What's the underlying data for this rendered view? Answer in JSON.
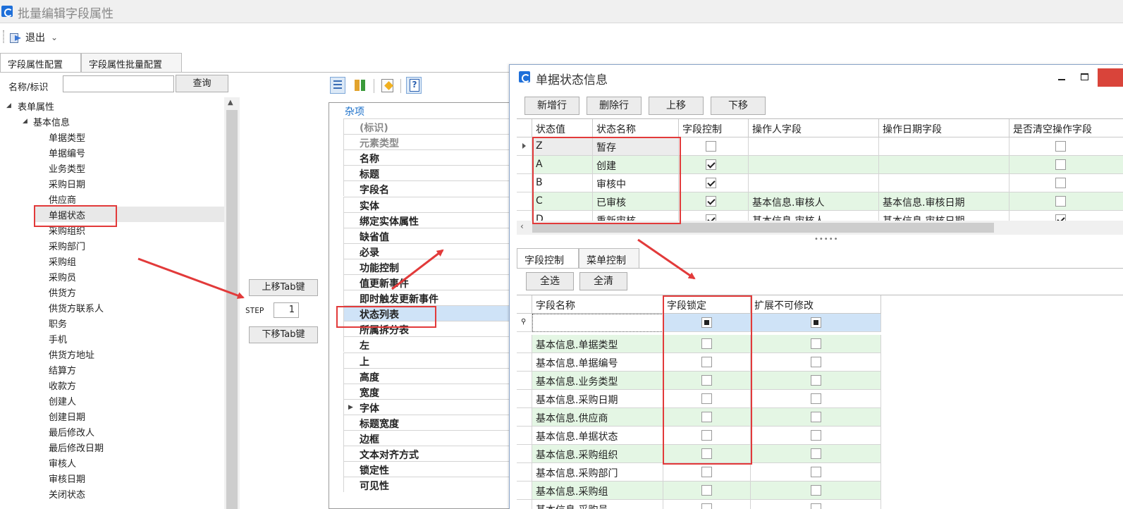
{
  "window": {
    "title": "批量编辑字段属性"
  },
  "toolbar": {
    "exit_label": "退出",
    "exit_chevron": "⌄"
  },
  "tabs": [
    {
      "label": "字段属性配置",
      "active": true
    },
    {
      "label": "字段属性批量配置",
      "active": false
    }
  ],
  "search": {
    "label": "名称/标识",
    "value": "",
    "button": "查询"
  },
  "tree": {
    "root": "表单属性",
    "group": "基本信息",
    "items": [
      "单据类型",
      "单据编号",
      "业务类型",
      "采购日期",
      "供应商",
      "单据状态",
      "采购组织",
      "采购部门",
      "采购组",
      "采购员",
      "供货方",
      "供货方联系人",
      "职务",
      "手机",
      "供货方地址",
      "结算方",
      "收款方",
      "创建人",
      "创建日期",
      "最后修改人",
      "最后修改日期",
      "审核人",
      "审核日期",
      "关闭状态"
    ],
    "selected": "单据状态"
  },
  "mid": {
    "up_button": "上移Tab键",
    "down_button": "下移Tab键",
    "step_label": "STEP",
    "step_value": "1"
  },
  "property_grid": {
    "category": "杂项",
    "rows": [
      {
        "label": "(标识)",
        "dim": true
      },
      {
        "label": "元素类型",
        "dim": true
      },
      {
        "label": "名称"
      },
      {
        "label": "标题"
      },
      {
        "label": "字段名"
      },
      {
        "label": "实体"
      },
      {
        "label": "绑定实体属性"
      },
      {
        "label": "缺省值"
      },
      {
        "label": "必录"
      },
      {
        "label": "功能控制"
      },
      {
        "label": "值更新事件"
      },
      {
        "label": "即时触发更新事件"
      },
      {
        "label": "状态列表",
        "selected": true
      },
      {
        "label": "所属拆分表"
      },
      {
        "label": "左"
      },
      {
        "label": "上"
      },
      {
        "label": "高度"
      },
      {
        "label": "宽度"
      },
      {
        "label": "字体",
        "expandable": true
      },
      {
        "label": "标题宽度"
      },
      {
        "label": "边框"
      },
      {
        "label": "文本对齐方式"
      },
      {
        "label": "锁定性"
      },
      {
        "label": "可见性"
      }
    ]
  },
  "dialog": {
    "title": "单据状态信息",
    "buttons": [
      "新增行",
      "删除行",
      "上移",
      "下移"
    ],
    "status_grid": {
      "columns": [
        "状态值",
        "状态名称",
        "字段控制",
        "操作人字段",
        "操作日期字段",
        "是否清空操作字段"
      ],
      "rows": [
        {
          "value": "Z",
          "name": "暂存",
          "field_control": false,
          "operator": "",
          "date": "",
          "clear": false,
          "current": true
        },
        {
          "value": "A",
          "name": "创建",
          "field_control": true,
          "operator": "",
          "date": "",
          "clear": false
        },
        {
          "value": "B",
          "name": "审核中",
          "field_control": true,
          "operator": "",
          "date": "",
          "clear": false
        },
        {
          "value": "C",
          "name": "已审核",
          "field_control": true,
          "operator": "基本信息.审核人",
          "date": "基本信息.审核日期",
          "clear": false
        },
        {
          "value": "D",
          "name": "重新审核",
          "field_control": true,
          "operator": "基本信息.审核人",
          "date": "基本信息.审核日期",
          "clear": true
        }
      ]
    },
    "splitter": "•••••",
    "inner_tabs": [
      {
        "label": "字段控制",
        "active": true
      },
      {
        "label": "菜单控制",
        "active": false
      }
    ],
    "select_all": "全选",
    "clear_all": "全清",
    "field_grid": {
      "columns": [
        "字段名称",
        "字段锁定",
        "扩展不可修改"
      ],
      "rows": [
        "基本信息.单据类型",
        "基本信息.单据编号",
        "基本信息.业务类型",
        "基本信息.采购日期",
        "基本信息.供应商",
        "基本信息.单据状态",
        "基本信息.采购组织",
        "基本信息.采购部门",
        "基本信息.采购组",
        "基本信息.采购员"
      ]
    }
  },
  "colors": {
    "green_row": "#e4f6e4",
    "annotation_red": "#e23a3a",
    "selected_blue": "#cfe3f7"
  }
}
